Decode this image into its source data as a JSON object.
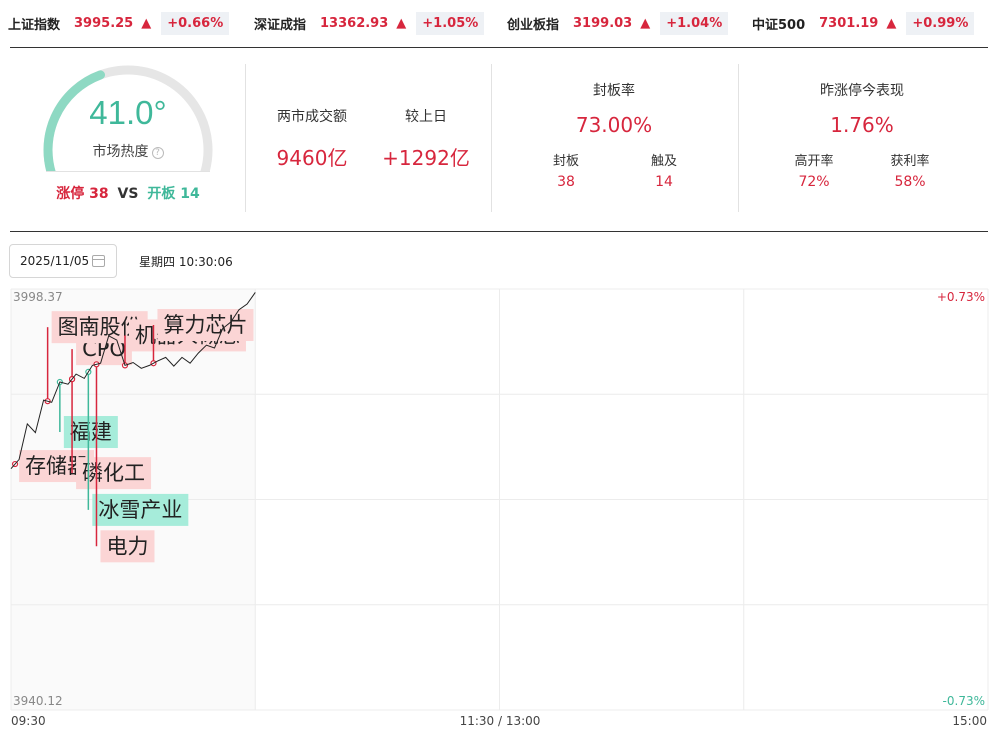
{
  "ticker": [
    {
      "name": "上证指数",
      "value": "3995.25",
      "arrow": "▲",
      "change": "+0.66%"
    },
    {
      "name": "深证成指",
      "value": "13362.93",
      "arrow": "▲",
      "change": "+1.05%"
    },
    {
      "name": "创业板指",
      "value": "3199.03",
      "arrow": "▲",
      "change": "+1.04%"
    },
    {
      "name": "中证500",
      "value": "7301.19",
      "arrow": "▲",
      "change": "+0.99%"
    }
  ],
  "heat": {
    "value": "41.0°",
    "fraction": 0.41,
    "label": "市场热度",
    "help_glyph": "?",
    "limit_up_label": "涨停",
    "limit_up_count": "38",
    "vs": "VS",
    "open_board_label": "开板",
    "open_board_count": "14"
  },
  "turnover": {
    "label": "两市成交额",
    "value": "9460亿",
    "diff_label": "较上日",
    "diff_value": "+1292亿"
  },
  "seal_rate": {
    "label": "封板率",
    "value": "73.00%",
    "sealed_label": "封板",
    "sealed_value": "38",
    "touched_label": "触及",
    "touched_value": "14"
  },
  "yesterday_limit": {
    "label": "昨涨停今表现",
    "value": "1.76%",
    "high_open_label": "高开率",
    "high_open_value": "72%",
    "profit_label": "获利率",
    "profit_value": "58%"
  },
  "date_picker": {
    "value": "2025/11/05",
    "icon": "calendar-icon"
  },
  "weekday_time": "星期四 10:30:06",
  "colors": {
    "up": "#d7263d",
    "down": "#3fb89a",
    "up_tag": "#fbd5d5",
    "down_tag": "#a6ecda"
  },
  "chart_data": {
    "type": "line",
    "y_top_label": "3998.37",
    "y_bottom_label": "3940.12",
    "right_top_label": "+0.73%",
    "right_bottom_label": "-0.73%",
    "x_labels": [
      "09:30",
      "11:30 / 13:00",
      "15:00"
    ],
    "ylim": [
      3940.12,
      3998.37
    ],
    "x_domain_minutes": [
      0,
      240
    ],
    "grid": true,
    "series": [
      {
        "x": [
          0,
          2,
          4,
          6,
          8,
          10,
          12,
          14,
          16,
          18,
          20,
          22,
          24,
          26,
          28,
          30,
          32,
          34,
          36,
          38,
          40,
          42,
          44,
          46,
          48,
          50,
          52,
          54,
          56,
          58,
          60
        ],
        "y": [
          3973.5,
          3974.8,
          3979.7,
          3978.5,
          3983.0,
          3982.7,
          3985.5,
          3985.2,
          3986.6,
          3986.0,
          3987.8,
          3988.1,
          3991.9,
          3991.3,
          3987.8,
          3988.2,
          3987.4,
          3987.8,
          3988.4,
          3988.9,
          3987.7,
          3988.9,
          3988.1,
          3989.5,
          3990.6,
          3990.2,
          3992.9,
          3993.8,
          3995.5,
          3996.3,
          3997.9
        ]
      }
    ],
    "annotations": [
      {
        "text": "存储器",
        "x": 1,
        "y": 3975.0,
        "dir": "up",
        "side": "up"
      },
      {
        "text": "CPO",
        "x": 15,
        "y": 3987.9,
        "dir": "up",
        "side": "up"
      },
      {
        "text": "图南股份",
        "x": 9,
        "y": 3983.1,
        "dir": "up",
        "side": "up"
      },
      {
        "text": "福建",
        "x": 12,
        "y": 3985.6,
        "dir": "down",
        "side": "down"
      },
      {
        "text": "磷化工",
        "x": 15,
        "y": 3988.0,
        "dir": "up",
        "side": "down"
      },
      {
        "text": "冰雪产业",
        "x": 19,
        "y": 3989.4,
        "dir": "down",
        "side": "down"
      },
      {
        "text": "电力",
        "x": 21,
        "y": 3988.0,
        "dir": "up",
        "side": "down"
      },
      {
        "text": "机器人概念",
        "x": 28,
        "y": 3988.1,
        "dir": "up",
        "side": "up"
      },
      {
        "text": "算力芯片",
        "x": 35,
        "y": 3988.3,
        "dir": "up",
        "side": "up"
      }
    ]
  }
}
